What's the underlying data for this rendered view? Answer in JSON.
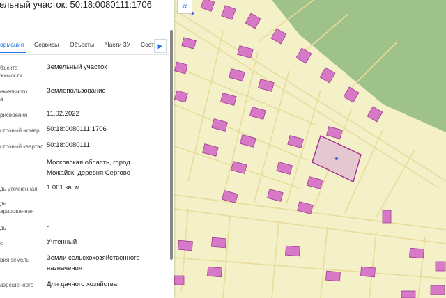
{
  "header": {
    "title": "ельный участок: 50:18:0080111:1706"
  },
  "tabs": [
    {
      "label": "ормация",
      "active": true
    },
    {
      "label": "Сервисы"
    },
    {
      "label": "Объекты"
    },
    {
      "label": "Части ЗУ"
    },
    {
      "label": "Состав"
    }
  ],
  "tab_scroll_icon": "chevron-right-icon",
  "collapse_icon": "double-chevron-left-icon",
  "properties": [
    {
      "label": "бъекта\nжимости",
      "value": "Земельный участок"
    },
    {
      "label": "емельного\nа",
      "value": "Землепользование"
    },
    {
      "label": "рисвоения",
      "value": "11.02.2022"
    },
    {
      "label": "стровый номер",
      "value": "50:18:0080111:1706"
    },
    {
      "label": "стровый квартал",
      "value": "50:18:0080111"
    },
    {
      "label": "",
      "value": "Московская область, город\nМожайск, деревня Сергово"
    },
    {
      "label": "дь уточненная",
      "value": "1 001 кв. м"
    },
    {
      "label": "дь\nарированная",
      "value": "-"
    },
    {
      "label": "дь",
      "value": "-"
    },
    {
      "label": "с",
      "value": "Учтенный"
    },
    {
      "label": "рия земель",
      "value": "Земли сельскохозяйственного\nназначения"
    },
    {
      "label": "азрешенного\n",
      "value": "Для дачного хозяйства"
    }
  ],
  "colors": {
    "map_background": "#f4f1c8",
    "forest": "#9ec28a",
    "parcel_border": "#e8dc9a",
    "building_fill": "#d779c6",
    "building_stroke": "#9b3f8e",
    "selected_fill": "#e0b8d4",
    "selected_stroke": "#a0308c",
    "accent": "#1a73e8"
  },
  "map": {
    "selected_parcel": "50:18:0080111:1706"
  }
}
